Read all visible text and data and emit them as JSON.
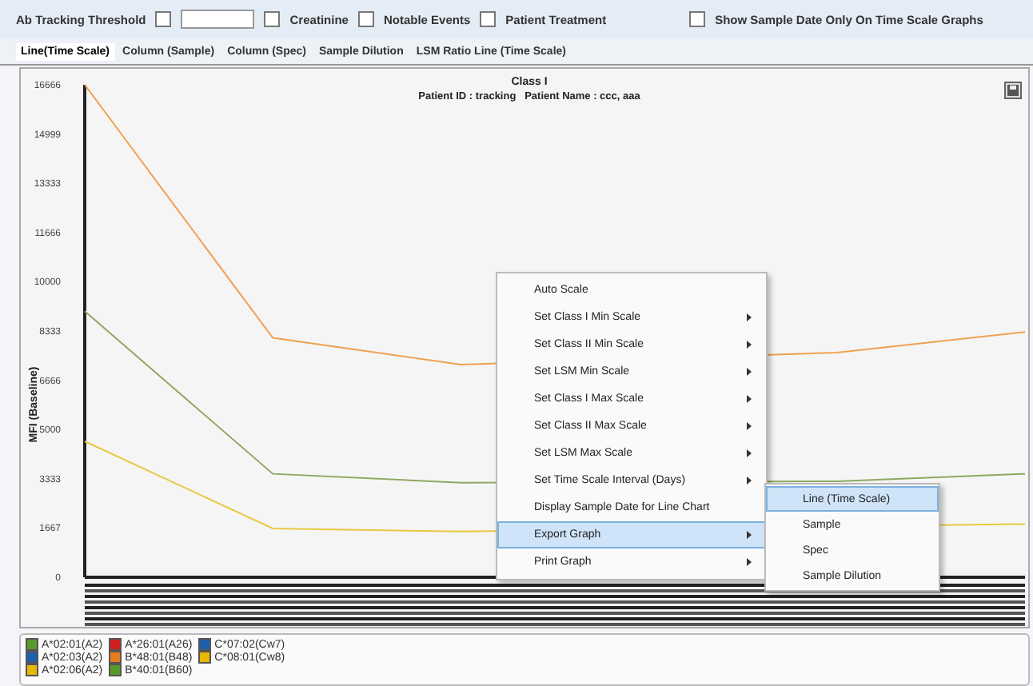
{
  "toolbar": {
    "items": [
      {
        "kind": "labeled_checkbox",
        "label": "Ab Tracking Threshold",
        "checked": false
      },
      {
        "kind": "input",
        "value": ""
      },
      {
        "kind": "checkbox",
        "label": "Creatinine",
        "checked": false
      },
      {
        "kind": "checkbox",
        "label": "Notable Events",
        "checked": false
      },
      {
        "kind": "checkbox",
        "label": "Patient Treatment",
        "checked": false
      },
      {
        "kind": "checkbox",
        "label": "Show Sample Date Only On Time Scale Graphs",
        "checked": false
      }
    ]
  },
  "tabs": [
    {
      "label": "Line(Time Scale)",
      "selected": true
    },
    {
      "label": "Column (Sample)",
      "selected": false
    },
    {
      "label": "Column (Spec)",
      "selected": false
    },
    {
      "label": "Sample Dilution",
      "selected": false
    },
    {
      "label": "LSM Ratio Line (Time Scale)",
      "selected": false
    }
  ],
  "chart": {
    "title": "Class I",
    "subtitle": "Patient ID : tracking   Patient Name : ccc, aaa",
    "chart_data": {
      "type": "line",
      "ylabel": "MFI (Baseline)",
      "ylim": [
        0,
        16666
      ],
      "yticks": [
        {
          "value": 0,
          "label": "0"
        },
        {
          "value": 1667,
          "label": "1667"
        },
        {
          "value": 3333,
          "label": "3333"
        },
        {
          "value": 5000,
          "label": "5000"
        },
        {
          "value": 6666,
          "label": "6666"
        },
        {
          "value": 8333,
          "label": "8333"
        },
        {
          "value": 10000,
          "label": "10000"
        },
        {
          "value": 11666,
          "label": "11666"
        },
        {
          "value": 13333,
          "label": "13333"
        },
        {
          "value": 14999,
          "label": "14999"
        },
        {
          "value": 16666,
          "label": "16666"
        }
      ],
      "series": [
        {
          "color": "#f0a050",
          "values": [
            16666,
            8100,
            7200,
            null,
            7600,
            8300
          ]
        },
        {
          "color": "#8fa860",
          "values": [
            9000,
            3500,
            3200,
            null,
            3250,
            3500
          ]
        },
        {
          "color": "#e8c840",
          "values": [
            4600,
            1650,
            1550,
            null,
            null,
            1800
          ]
        }
      ]
    }
  },
  "context_menu": {
    "items": [
      {
        "label": "Auto Scale",
        "submenu": false,
        "selected": false
      },
      {
        "label": "Set Class I Min Scale",
        "submenu": true,
        "selected": false
      },
      {
        "label": "Set Class II Min Scale",
        "submenu": true,
        "selected": false
      },
      {
        "label": "Set LSM Min Scale",
        "submenu": true,
        "selected": false
      },
      {
        "label": "Set Class I Max Scale",
        "submenu": true,
        "selected": false
      },
      {
        "label": "Set Class II Max Scale",
        "submenu": true,
        "selected": false
      },
      {
        "label": "Set LSM Max Scale",
        "submenu": true,
        "selected": false
      },
      {
        "label": "Set Time Scale Interval (Days)",
        "submenu": true,
        "selected": false
      },
      {
        "label": "Display Sample Date for Line Chart",
        "submenu": false,
        "selected": false
      },
      {
        "label": "Export Graph",
        "submenu": true,
        "selected": true
      },
      {
        "label": "Print Graph",
        "submenu": true,
        "selected": false
      }
    ],
    "submenu": [
      {
        "label": "Line (Time Scale)",
        "selected": true
      },
      {
        "label": "Sample",
        "selected": false
      },
      {
        "label": "Spec",
        "selected": false
      },
      {
        "label": "Sample Dilution",
        "selected": false
      }
    ]
  },
  "legend": [
    {
      "label": "A*02:01(A2)",
      "color": "#5a9a2a"
    },
    {
      "label": "A*26:01(A26)",
      "color": "#d02020"
    },
    {
      "label": "C*07:02(Cw7)",
      "color": "#1f5fb0"
    },
    {
      "label": "A*02:03(A2)",
      "color": "#1f5fb0"
    },
    {
      "label": "B*48:01(B48)",
      "color": "#e87a20"
    },
    {
      "label": "C*08:01(Cw8)",
      "color": "#e8b800"
    },
    {
      "label": "A*02:06(A2)",
      "color": "#e8b800"
    },
    {
      "label": "B*40:01(B60)",
      "color": "#5a9a2a"
    }
  ]
}
